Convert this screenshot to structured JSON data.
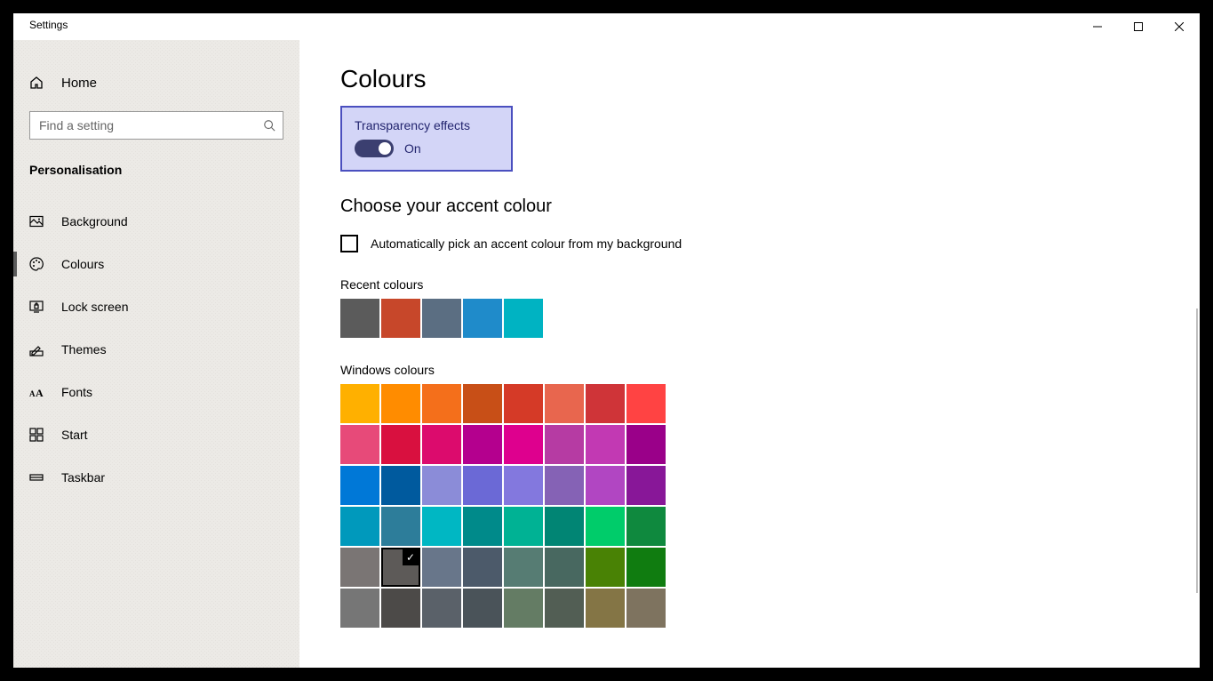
{
  "window": {
    "title": "Settings"
  },
  "sidebar": {
    "home_label": "Home",
    "search_placeholder": "Find a setting",
    "category": "Personalisation",
    "items": [
      {
        "key": "background",
        "label": "Background",
        "icon": "picture-icon"
      },
      {
        "key": "colours",
        "label": "Colours",
        "icon": "palette-icon",
        "active": true
      },
      {
        "key": "lock-screen",
        "label": "Lock screen",
        "icon": "lockscreen-icon"
      },
      {
        "key": "themes",
        "label": "Themes",
        "icon": "pencil-icon"
      },
      {
        "key": "fonts",
        "label": "Fonts",
        "icon": "fonts-icon"
      },
      {
        "key": "start",
        "label": "Start",
        "icon": "start-icon"
      },
      {
        "key": "taskbar",
        "label": "Taskbar",
        "icon": "taskbar-icon"
      }
    ]
  },
  "page": {
    "title": "Colours",
    "transparency": {
      "label": "Transparency effects",
      "state": "On",
      "value": true
    },
    "accent_heading": "Choose your accent colour",
    "auto_pick_label": "Automatically pick an accent colour from my background",
    "auto_pick_checked": false,
    "recent_label": "Recent colours",
    "recent_colours": [
      "#5b5b5b",
      "#c7472a",
      "#5b6e82",
      "#1f8bca",
      "#00b3c2"
    ],
    "windows_label": "Windows colours",
    "selected_index": 33,
    "windows_colours": [
      "#ffb000",
      "#ff8c00",
      "#f46f1b",
      "#c84f17",
      "#d53a27",
      "#e8664e",
      "#cf3438",
      "#ff4343",
      "#e74a79",
      "#d9103f",
      "#dc0b6d",
      "#b4008e",
      "#de008e",
      "#b63ba3",
      "#c239b3",
      "#9a0089",
      "#0078d7",
      "#005a9e",
      "#8b8cd8",
      "#6b69d6",
      "#8378de",
      "#8562b5",
      "#b146c2",
      "#881798",
      "#0099bc",
      "#2d7d9a",
      "#00b7c3",
      "#008a8a",
      "#00b294",
      "#018574",
      "#00cc6a",
      "#0f893e",
      "#7a7574",
      "#5d5a58",
      "#68768a",
      "#4c5a6a",
      "#567c73",
      "#486860",
      "#498205",
      "#107c10",
      "#767676",
      "#4c4a48",
      "#5a6169",
      "#4a5359",
      "#647c64",
      "#525e54",
      "#847545",
      "#7e735f"
    ]
  }
}
